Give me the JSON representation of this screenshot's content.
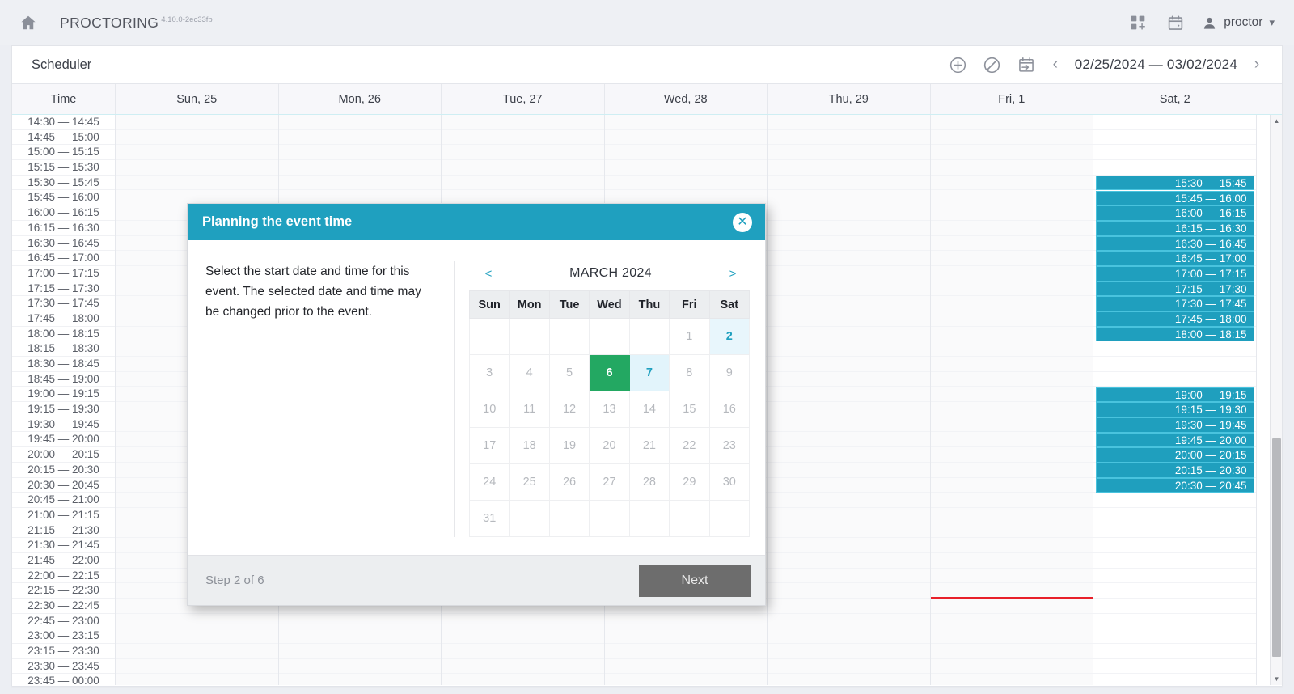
{
  "app_bar": {
    "home_icon": "home-icon",
    "brand": "PROCTORING",
    "version": "4.10.0-2ec33fb",
    "grid_icon": "add-grid-icon",
    "calendar_icon": "calendar-icon",
    "user_icon": "person-icon",
    "user_name": "proctor",
    "chevron": "▾"
  },
  "scheduler": {
    "title": "Scheduler",
    "tools": [
      {
        "name": "add-event-icon",
        "glyph": "⊕"
      },
      {
        "name": "block-icon",
        "glyph": "⊘"
      },
      {
        "name": "calendar-range-icon",
        "glyph": "📅"
      }
    ],
    "prev_arrow": "‹",
    "next_arrow": "›",
    "date_range": "02/25/2024 — 03/02/2024"
  },
  "grid": {
    "time_header": "Time",
    "day_headers": [
      "Sun, 25",
      "Mon, 26",
      "Tue, 27",
      "Wed, 28",
      "Thu, 29",
      "Fri, 1",
      "Sat, 2"
    ],
    "time_slots": [
      "14:30 — 14:45",
      "14:45 — 15:00",
      "15:00 — 15:15",
      "15:15 — 15:30",
      "15:30 — 15:45",
      "15:45 — 16:00",
      "16:00 — 16:15",
      "16:15 — 16:30",
      "16:30 — 16:45",
      "16:45 — 17:00",
      "17:00 — 17:15",
      "17:15 — 17:30",
      "17:30 — 17:45",
      "17:45 — 18:00",
      "18:00 — 18:15",
      "18:15 — 18:30",
      "18:30 — 18:45",
      "18:45 — 19:00",
      "19:00 — 19:15",
      "19:15 — 19:30",
      "19:30 — 19:45",
      "19:45 — 20:00",
      "20:00 — 20:15",
      "20:15 — 20:30",
      "20:30 — 20:45",
      "20:45 — 21:00",
      "21:00 — 21:15",
      "21:15 — 21:30",
      "21:30 — 21:45",
      "21:45 — 22:00",
      "22:00 — 22:15",
      "22:15 — 22:30",
      "22:30 — 22:45",
      "22:45 — 23:00",
      "23:00 — 23:15",
      "23:15 — 23:30",
      "23:30 — 23:45",
      "23:45 — 00:00"
    ],
    "events_saturday": [
      "15:30 — 15:45",
      "15:45 — 16:00",
      "16:00 — 16:15",
      "16:15 — 16:30",
      "16:30 — 16:45",
      "16:45 — 17:00",
      "17:00 — 17:15",
      "17:15 — 17:30",
      "17:30 — 17:45",
      "17:45 — 18:00",
      "18:00 — 18:15",
      "19:00 — 19:15",
      "19:15 — 19:30",
      "19:30 — 19:45",
      "19:45 — 20:00",
      "20:00 — 20:15",
      "20:15 — 20:30",
      "20:30 — 20:45"
    ],
    "event_slot_indices": [
      4,
      5,
      6,
      7,
      8,
      9,
      10,
      11,
      12,
      13,
      14,
      18,
      19,
      20,
      21,
      22,
      23,
      24
    ],
    "now_line_column": "Fri, 1",
    "accent_color": "#1fa0bf",
    "now_line_color": "#e8202a"
  },
  "dialog": {
    "title": "Planning the event time",
    "close_icon": "close-icon",
    "description": "Select the start date and time for this event. The selected date and time may be changed prior to the event.",
    "calendar": {
      "prev": "<",
      "next": ">",
      "month": "MARCH 2024",
      "weekdays": [
        "Sun",
        "Mon",
        "Tue",
        "Wed",
        "Thu",
        "Fri",
        "Sat"
      ],
      "weeks": [
        [
          {
            "d": "",
            "cls": "empty"
          },
          {
            "d": "",
            "cls": "empty"
          },
          {
            "d": "",
            "cls": "empty"
          },
          {
            "d": "",
            "cls": "empty"
          },
          {
            "d": "",
            "cls": "empty"
          },
          {
            "d": "1",
            "cls": ""
          },
          {
            "d": "2",
            "cls": "hl"
          }
        ],
        [
          {
            "d": "3",
            "cls": ""
          },
          {
            "d": "4",
            "cls": ""
          },
          {
            "d": "5",
            "cls": ""
          },
          {
            "d": "6",
            "cls": "sel"
          },
          {
            "d": "7",
            "cls": "today"
          },
          {
            "d": "8",
            "cls": ""
          },
          {
            "d": "9",
            "cls": ""
          }
        ],
        [
          {
            "d": "10",
            "cls": ""
          },
          {
            "d": "11",
            "cls": ""
          },
          {
            "d": "12",
            "cls": ""
          },
          {
            "d": "13",
            "cls": ""
          },
          {
            "d": "14",
            "cls": ""
          },
          {
            "d": "15",
            "cls": ""
          },
          {
            "d": "16",
            "cls": ""
          }
        ],
        [
          {
            "d": "17",
            "cls": ""
          },
          {
            "d": "18",
            "cls": ""
          },
          {
            "d": "19",
            "cls": ""
          },
          {
            "d": "20",
            "cls": ""
          },
          {
            "d": "21",
            "cls": ""
          },
          {
            "d": "22",
            "cls": ""
          },
          {
            "d": "23",
            "cls": ""
          }
        ],
        [
          {
            "d": "24",
            "cls": ""
          },
          {
            "d": "25",
            "cls": ""
          },
          {
            "d": "26",
            "cls": ""
          },
          {
            "d": "27",
            "cls": ""
          },
          {
            "d": "28",
            "cls": ""
          },
          {
            "d": "29",
            "cls": ""
          },
          {
            "d": "30",
            "cls": ""
          }
        ],
        [
          {
            "d": "31",
            "cls": ""
          },
          {
            "d": "",
            "cls": "empty"
          },
          {
            "d": "",
            "cls": "empty"
          },
          {
            "d": "",
            "cls": "empty"
          },
          {
            "d": "",
            "cls": "empty"
          },
          {
            "d": "",
            "cls": "empty"
          },
          {
            "d": "",
            "cls": "empty"
          }
        ]
      ],
      "selected_color": "#23a862",
      "today_color": "#e2f4fb"
    },
    "step_label": "Step 2 of 6",
    "next_label": "Next"
  }
}
